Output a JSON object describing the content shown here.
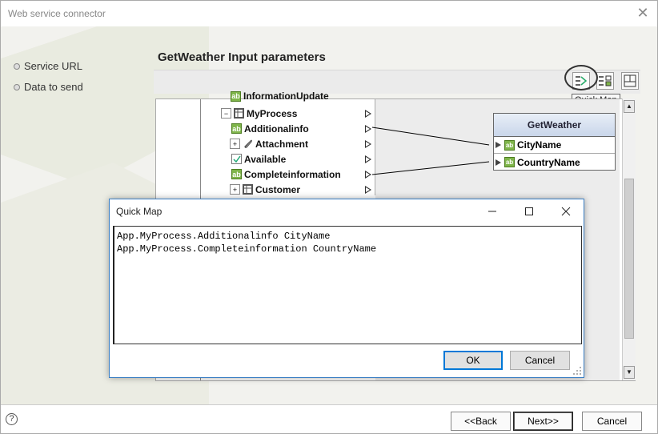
{
  "window": {
    "title": "Web service connector",
    "close_glyph": "✕"
  },
  "nav": {
    "items": [
      {
        "label": "Service URL"
      },
      {
        "label": "Data to send"
      }
    ]
  },
  "section": {
    "title": "GetWeather Input parameters"
  },
  "toolbar": {
    "tooltip": "Quick Map",
    "icons": [
      "quick-map-icon",
      "auto-map-icon",
      "layout-icon"
    ]
  },
  "tree": {
    "items": [
      {
        "label": "InformationUpdate",
        "icon": "text-icon",
        "expandable": false
      },
      {
        "label": "MyProcess",
        "icon": "table-icon",
        "expandable": true
      },
      {
        "label": "Additionalinfo",
        "icon": "text-icon",
        "expandable": false
      },
      {
        "label": "Attachment",
        "icon": "attachment-icon",
        "expandable": true
      },
      {
        "label": "Available",
        "icon": "checkbox-icon",
        "expandable": false
      },
      {
        "label": "Completeinformation",
        "icon": "text-icon",
        "expandable": false
      },
      {
        "label": "Customer",
        "icon": "table-icon",
        "expandable": true
      }
    ]
  },
  "target": {
    "title": "GetWeather",
    "fields": [
      {
        "label": "CityName"
      },
      {
        "label": "CountryName"
      }
    ]
  },
  "dialog": {
    "title": "Quick Map",
    "lines": "App.MyProcess.Additionalinfo CityName\nApp.MyProcess.Completeinformation CountryName\n",
    "ok_label": "OK",
    "cancel_label": "Cancel"
  },
  "footer": {
    "help_glyph": "?",
    "back_label": "<<Back",
    "next_label": "Next>>",
    "cancel_label": "Cancel"
  },
  "colors": {
    "accent": "#0078d7",
    "field_icon": "#7fb54a",
    "header_gradient": "#c9d6ea"
  }
}
